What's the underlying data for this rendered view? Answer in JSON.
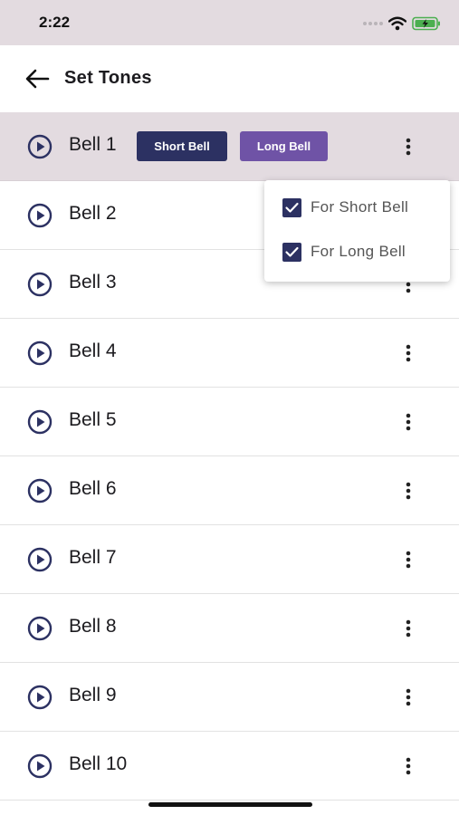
{
  "status_bar": {
    "time": "2:22"
  },
  "app_bar": {
    "title": "Set Tones"
  },
  "bells": [
    {
      "label": "Bell 1",
      "selected": true
    },
    {
      "label": "Bell 2"
    },
    {
      "label": "Bell 3"
    },
    {
      "label": "Bell 4"
    },
    {
      "label": "Bell 5"
    },
    {
      "label": "Bell 6"
    },
    {
      "label": "Bell 7"
    },
    {
      "label": "Bell 8"
    },
    {
      "label": "Bell 9"
    },
    {
      "label": "Bell 10"
    }
  ],
  "chips": {
    "short": "Short Bell",
    "long": "Long Bell"
  },
  "popup": {
    "items": [
      {
        "label": "For Short Bell",
        "checked": true
      },
      {
        "label": "For Long Bell",
        "checked": true
      }
    ]
  },
  "colors": {
    "accent_dark": "#2c3162",
    "accent_purple": "#6f53a6",
    "selected_row": "#e3dbe0",
    "battery": "#4caf50"
  },
  "icons": [
    "back-arrow-icon",
    "play-circle-icon",
    "more-vert-icon",
    "checkbox-icon",
    "wifi-icon",
    "battery-icon"
  ]
}
